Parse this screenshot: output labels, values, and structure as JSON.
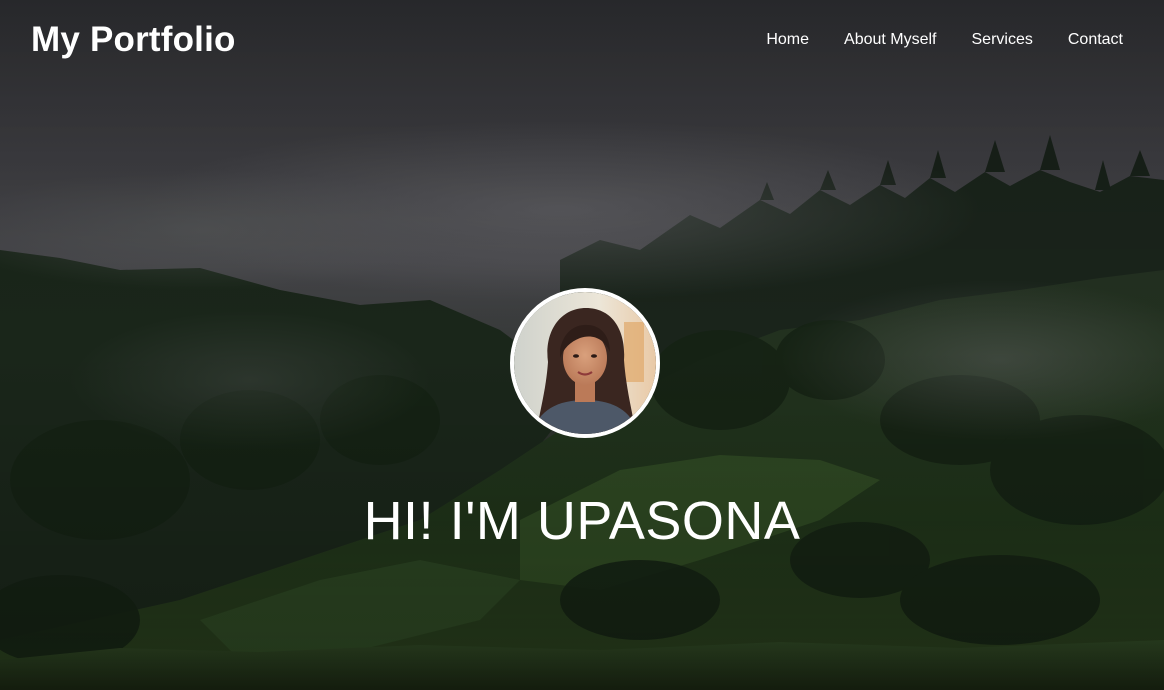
{
  "header": {
    "logo": "My Portfolio",
    "nav": [
      {
        "label": "Home"
      },
      {
        "label": "About Myself"
      },
      {
        "label": "Services"
      },
      {
        "label": "Contact"
      }
    ]
  },
  "hero": {
    "headline": "HI! I'M UPASONA",
    "background": "misty-forested-hills-photo",
    "avatar": "profile-photo"
  },
  "colors": {
    "text": "#ffffff",
    "sky": "#3c3c40",
    "forest": "#1b2a1c",
    "grass": "#2f4a22"
  }
}
